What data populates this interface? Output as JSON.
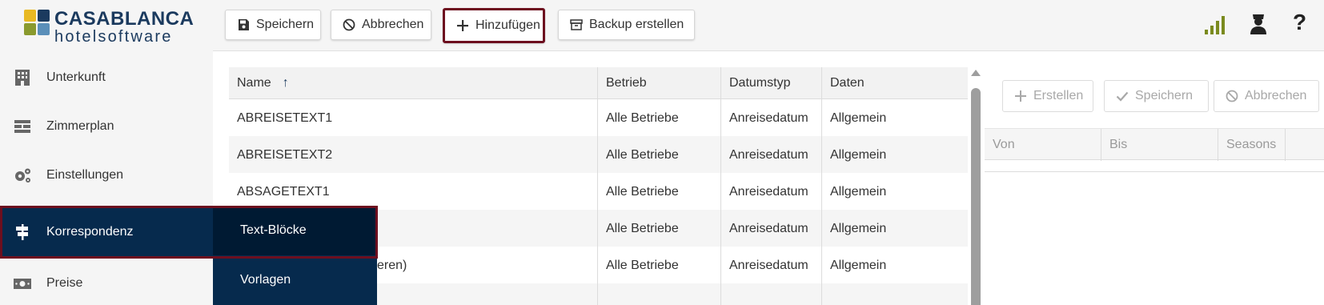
{
  "brand": {
    "title": "CASABLANCA",
    "subtitle": "hotelsoftware",
    "colors": {
      "blue": "#1b3a5e",
      "yellow": "#e8b923",
      "green": "#8a9a2e",
      "lightblue": "#5b8fb9"
    }
  },
  "sidebar": {
    "items": [
      {
        "label": "Unterkunft",
        "icon": "building-icon"
      },
      {
        "label": "Zimmerplan",
        "icon": "room-plan-icon"
      },
      {
        "label": "Einstellungen",
        "icon": "gears-icon"
      },
      {
        "label": "Korrespondenz",
        "icon": "signpost-icon",
        "active": true
      },
      {
        "label": "Preise",
        "icon": "money-icon"
      }
    ],
    "submenu": [
      {
        "label": "Text-Blöcke",
        "active": true
      },
      {
        "label": "Vorlagen"
      }
    ]
  },
  "toolbar": {
    "buttons": [
      {
        "label": "Speichern",
        "icon": "save-icon"
      },
      {
        "label": "Abbrechen",
        "icon": "ban-icon"
      },
      {
        "label": "Hinzufügen",
        "icon": "plus-icon",
        "highlighted": true
      },
      {
        "label": "Backup erstellen",
        "icon": "archive-icon"
      }
    ],
    "right_icons": [
      "signal-icon",
      "user-icon",
      "help-icon"
    ],
    "help_label": "?"
  },
  "table": {
    "columns": [
      "Name",
      "Betrieb",
      "Datumstyp",
      "Daten"
    ],
    "sort_indicator": "↑",
    "rows": [
      {
        "name": "ABREISETEXT1",
        "betrieb": "Alle Betriebe",
        "datumstyp": "Anreisedatum",
        "daten": "Allgemein"
      },
      {
        "name": "ABREISETEXT2",
        "betrieb": "Alle Betriebe",
        "datumstyp": "Anreisedatum",
        "daten": "Allgemein"
      },
      {
        "name": "ABSAGETEXT1",
        "betrieb": "Alle Betriebe",
        "datumstyp": "Anreisedatum",
        "daten": "Allgemein"
      },
      {
        "name": "",
        "betrieb": "Alle Betriebe",
        "datumstyp": "Anreisedatum",
        "daten": "Allgemein"
      },
      {
        "name": "eren)",
        "betrieb": "Alle Betriebe",
        "datumstyp": "Anreisedatum",
        "daten": "Allgemein"
      }
    ]
  },
  "right_panel": {
    "buttons": [
      {
        "label": "Erstellen",
        "icon": "plus-icon"
      },
      {
        "label": "Speichern",
        "icon": "check-icon"
      },
      {
        "label": "Abbrechen",
        "icon": "ban-icon"
      }
    ],
    "columns": [
      "Von",
      "Bis",
      "Seasons"
    ]
  }
}
